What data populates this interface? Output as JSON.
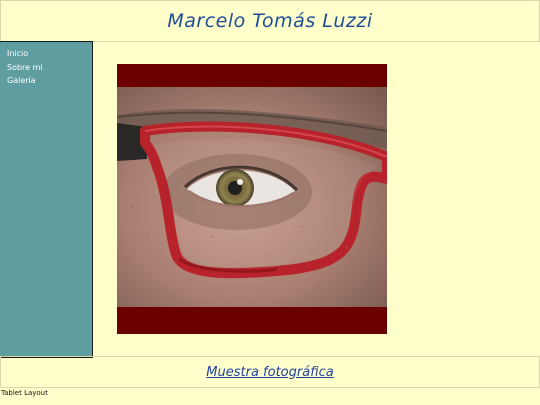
{
  "header": {
    "title": "Marcelo Tomás Luzzi"
  },
  "sidebar": {
    "items": [
      {
        "label": "Inicio"
      },
      {
        "label": "Sobre mi"
      },
      {
        "label": "Galería"
      }
    ]
  },
  "main": {
    "photo": {
      "subject": "close-up of an eye behind red glasses"
    }
  },
  "footer": {
    "link_label": "Muestra fotográfica"
  },
  "status": {
    "layout_label": "Tablet Layout"
  },
  "colors": {
    "background": "#ffffcc",
    "title": "#1f4e99",
    "sidebar": "#5f9ea0",
    "frame": "#6b0000",
    "glasses": "#c0262b",
    "link": "#1f3fa8"
  }
}
